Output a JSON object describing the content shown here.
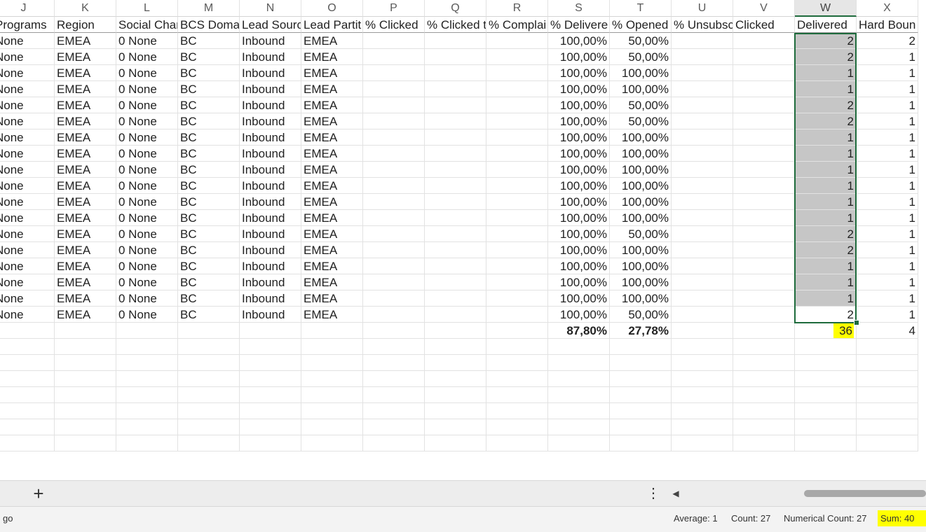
{
  "columns": [
    {
      "letter": "J",
      "header": "Programs",
      "selected": false
    },
    {
      "letter": "K",
      "header": "Region",
      "selected": false
    },
    {
      "letter": "L",
      "header": "Social Char",
      "selected": false
    },
    {
      "letter": "M",
      "header": "BCS Doma",
      "selected": false
    },
    {
      "letter": "N",
      "header": "Lead Sourc",
      "selected": false
    },
    {
      "letter": "O",
      "header": "Lead Partit",
      "selected": false
    },
    {
      "letter": "P",
      "header": "% Clicked",
      "selected": false
    },
    {
      "letter": "Q",
      "header": "% Clicked t",
      "selected": false
    },
    {
      "letter": "R",
      "header": "% Complai",
      "selected": false
    },
    {
      "letter": "S",
      "header": "% Delivere",
      "selected": false
    },
    {
      "letter": "T",
      "header": "% Opened",
      "selected": false
    },
    {
      "letter": "U",
      "header": "% Unsubsc",
      "selected": false
    },
    {
      "letter": "V",
      "header": "Clicked",
      "selected": false
    },
    {
      "letter": "W",
      "header": "Delivered",
      "selected": true
    },
    {
      "letter": "X",
      "header": "Hard Boun",
      "selected": false
    }
  ],
  "rows": [
    [
      "None",
      "EMEA",
      "0 None",
      "BC",
      "Inbound",
      "EMEA",
      "",
      "",
      "",
      "100,00%",
      "50,00%",
      "",
      "",
      "2",
      "2"
    ],
    [
      "None",
      "EMEA",
      "0 None",
      "BC",
      "Inbound",
      "EMEA",
      "",
      "",
      "",
      "100,00%",
      "50,00%",
      "",
      "",
      "2",
      "1"
    ],
    [
      "None",
      "EMEA",
      "0 None",
      "BC",
      "Inbound",
      "EMEA",
      "",
      "",
      "",
      "100,00%",
      "100,00%",
      "",
      "",
      "1",
      "1"
    ],
    [
      "None",
      "EMEA",
      "0 None",
      "BC",
      "Inbound",
      "EMEA",
      "",
      "",
      "",
      "100,00%",
      "100,00%",
      "",
      "",
      "1",
      "1"
    ],
    [
      "None",
      "EMEA",
      "0 None",
      "BC",
      "Inbound",
      "EMEA",
      "",
      "",
      "",
      "100,00%",
      "50,00%",
      "",
      "",
      "2",
      "1"
    ],
    [
      "None",
      "EMEA",
      "0 None",
      "BC",
      "Inbound",
      "EMEA",
      "",
      "",
      "",
      "100,00%",
      "50,00%",
      "",
      "",
      "2",
      "1"
    ],
    [
      "None",
      "EMEA",
      "0 None",
      "BC",
      "Inbound",
      "EMEA",
      "",
      "",
      "",
      "100,00%",
      "100,00%",
      "",
      "",
      "1",
      "1"
    ],
    [
      "None",
      "EMEA",
      "0 None",
      "BC",
      "Inbound",
      "EMEA",
      "",
      "",
      "",
      "100,00%",
      "100,00%",
      "",
      "",
      "1",
      "1"
    ],
    [
      "None",
      "EMEA",
      "0 None",
      "BC",
      "Inbound",
      "EMEA",
      "",
      "",
      "",
      "100,00%",
      "100,00%",
      "",
      "",
      "1",
      "1"
    ],
    [
      "None",
      "EMEA",
      "0 None",
      "BC",
      "Inbound",
      "EMEA",
      "",
      "",
      "",
      "100,00%",
      "100,00%",
      "",
      "",
      "1",
      "1"
    ],
    [
      "None",
      "EMEA",
      "0 None",
      "BC",
      "Inbound",
      "EMEA",
      "",
      "",
      "",
      "100,00%",
      "100,00%",
      "",
      "",
      "1",
      "1"
    ],
    [
      "None",
      "EMEA",
      "0 None",
      "BC",
      "Inbound",
      "EMEA",
      "",
      "",
      "",
      "100,00%",
      "100,00%",
      "",
      "",
      "1",
      "1"
    ],
    [
      "None",
      "EMEA",
      "0 None",
      "BC",
      "Inbound",
      "EMEA",
      "",
      "",
      "",
      "100,00%",
      "50,00%",
      "",
      "",
      "2",
      "1"
    ],
    [
      "None",
      "EMEA",
      "0 None",
      "BC",
      "Inbound",
      "EMEA",
      "",
      "",
      "",
      "100,00%",
      "100,00%",
      "",
      "",
      "2",
      "1"
    ],
    [
      "None",
      "EMEA",
      "0 None",
      "BC",
      "Inbound",
      "EMEA",
      "",
      "",
      "",
      "100,00%",
      "100,00%",
      "",
      "",
      "1",
      "1"
    ],
    [
      "None",
      "EMEA",
      "0 None",
      "BC",
      "Inbound",
      "EMEA",
      "",
      "",
      "",
      "100,00%",
      "100,00%",
      "",
      "",
      "1",
      "1"
    ],
    [
      "None",
      "EMEA",
      "0 None",
      "BC",
      "Inbound",
      "EMEA",
      "",
      "",
      "",
      "100,00%",
      "100,00%",
      "",
      "",
      "1",
      "1"
    ],
    [
      "None",
      "EMEA",
      "0 None",
      "BC",
      "Inbound",
      "EMEA",
      "",
      "",
      "",
      "100,00%",
      "50,00%",
      "",
      "",
      "2",
      "1"
    ]
  ],
  "totals": [
    "",
    "",
    "",
    "",
    "",
    "",
    "",
    "",
    "",
    "87,80%",
    "27,78%",
    "",
    "",
    "36",
    "4"
  ],
  "selection": {
    "column": "W",
    "highlight_color": "#ffff00",
    "selection_color": "#1e6b3c"
  },
  "toolbar": {
    "add_sheet_label": "+",
    "more_label": "⋮",
    "scroll_left_label": "◀"
  },
  "status": {
    "left_text": "go",
    "average": "Average: 1",
    "count": "Count: 27",
    "numerical_count": "Numerical Count: 27",
    "sum": "Sum: 40"
  }
}
